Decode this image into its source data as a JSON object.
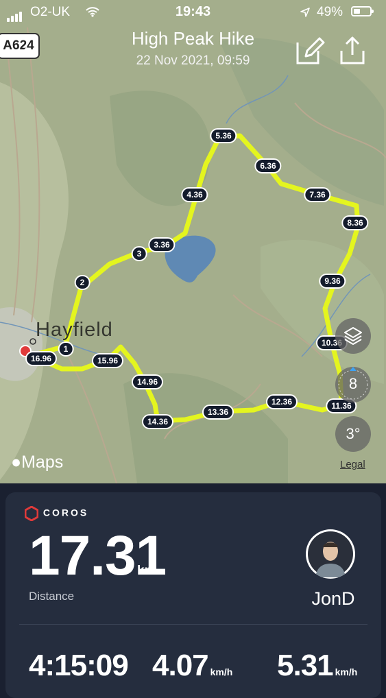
{
  "status_bar": {
    "carrier": "O2-UK",
    "time": "19:43",
    "battery_pct": "49%"
  },
  "header": {
    "title": "High Peak Hike",
    "subtitle": "22 Nov 2021, 09:59",
    "road_sign": "A624"
  },
  "map": {
    "town_label": "Hayfield",
    "route_color": "#e4f51f",
    "markers": [
      "1",
      "2",
      "3",
      "3.36",
      "4.36",
      "5.36",
      "6.36",
      "7.36",
      "8.36",
      "9.36",
      "10.36",
      "11.36",
      "12.36",
      "13.36",
      "14.36",
      "14.96",
      "15.96",
      "16.96"
    ],
    "compass_value": "8",
    "tilt_value": "3°",
    "maps_brand": "Maps",
    "legal": "Legal",
    "icons": [
      "back-chevron-icon",
      "edit-icon",
      "share-icon",
      "layers-icon",
      "compass-icon",
      "location-arrow-icon",
      "wifi-icon",
      "battery-icon",
      "apple-icon"
    ]
  },
  "summary": {
    "brand": "COROS",
    "distance_value": "17.31",
    "distance_unit": "km",
    "distance_label": "Distance",
    "username": "JonD",
    "duration": "4:15:09",
    "speed_value": "4.07",
    "speed_unit": "km/h",
    "pace_value": "5.31",
    "pace_unit": "km/h"
  }
}
